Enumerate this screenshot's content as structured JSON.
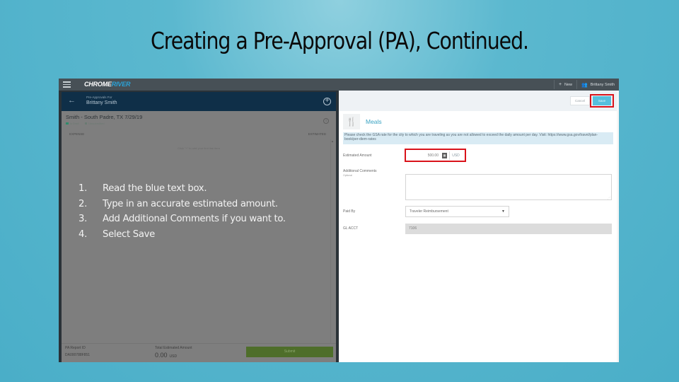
{
  "slide": {
    "title": "Creating a Pre-Approval (PA), Continued."
  },
  "app": {
    "logo": {
      "part1": "CHROME",
      "part2": "RIVER"
    },
    "topbar": {
      "new_label": "New",
      "new_icon": "plus-icon",
      "user_name": "Brittany Smith",
      "user_icon": "users-icon"
    }
  },
  "left_panel": {
    "header": {
      "subtitle": "Pre-Approvals For",
      "name": "Brittany Smith",
      "back_icon": "←",
      "add_icon": "+"
    },
    "trip": {
      "title": "Smith - South Padre, TX 7/29/19",
      "meta": [
        "In Draft",
        "Unsubmitted"
      ],
      "colors": {
        "draft": "#2f8a6a",
        "unsubmitted": "#6a7a72"
      }
    },
    "columns": {
      "expense": "EXPENSE",
      "estimated": "ESTIMATED"
    },
    "empty_hint": "Click \"+\" to add your first line item",
    "steps": [
      {
        "num": "1.",
        "text": "Read the blue text box."
      },
      {
        "num": "2.",
        "text": "Type in an accurate estimated  amount."
      },
      {
        "num": "3.",
        "text": "Add Additional Comments if you want to."
      },
      {
        "num": "4.",
        "text": "Select Save"
      }
    ],
    "footer": {
      "pa_label": "PA Report ID",
      "pa_value": "DA000788F851",
      "total_label": "Total Estimated Amount",
      "total_value": "0.00",
      "total_currency": "USD",
      "submit_label": "Submit"
    }
  },
  "right_panel": {
    "toolbar": {
      "cancel_label": "Cancel",
      "save_label": "Save"
    },
    "expense_type": {
      "icon": "fork-knife-icon",
      "title": "Meals"
    },
    "notice": "Please check the GSA rate for the city to which you are traveling as you are not allowed to exceed the daily amount per day. Visit: https://www.gsa.gov/travel/plan-book/per-diem-rates",
    "fields": {
      "estimated_amount": {
        "label": "Estimated Amount",
        "value": "500.00",
        "currency": "USD"
      },
      "additional_comments": {
        "label": "Additional Comments",
        "hint": "Optional",
        "value": ""
      },
      "paid_by": {
        "label": "Paid By",
        "value": "Traveler Reimbursement"
      },
      "gl_acct": {
        "label": "GL ACCT",
        "value": "7106"
      }
    }
  },
  "colors": {
    "highlight_red": "#d9121a",
    "save_blue": "#55bfdd",
    "submit_green": "#4e6e2a",
    "header_navy": "#0f2f48",
    "topbar_gray": "#475056",
    "link_blue": "#3aa3c2"
  }
}
